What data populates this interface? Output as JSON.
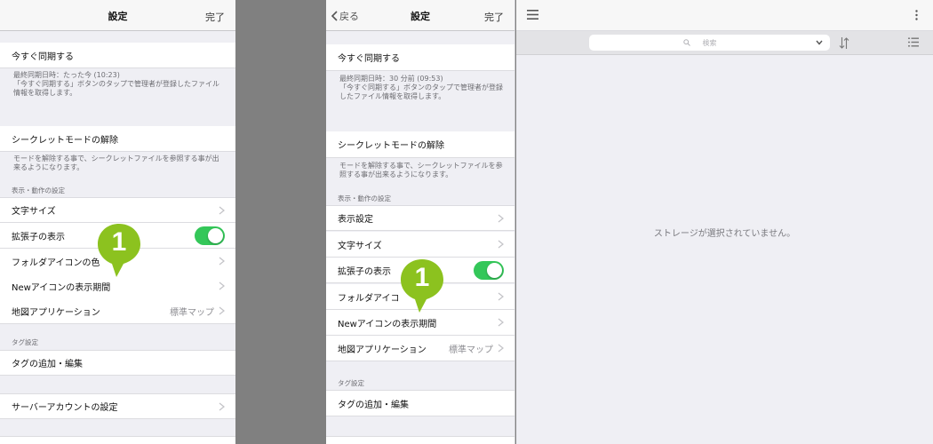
{
  "left": {
    "nav_title": "設定",
    "done_label": "完了",
    "sync_now": "今すぐ同期する",
    "sync_note": "最終同期日時：たった今 (10:23)\n「今すぐ同期する」ボタンのタップで管理者が登録したファイル情報を取得します。",
    "secret_mode": "シークレットモードの解除",
    "secret_note": "モードを解除する事で、シークレットファイルを参照する事が出来るようになります。",
    "display_section": "表示・動作の設定",
    "font_size": "文字サイズ",
    "show_ext": "拡張子の表示",
    "folder_icon_color": "フォルダアイコンの色",
    "new_icon_period": "Newアイコンの表示期間",
    "map_app": "地図アプリケーション",
    "map_app_value": "標準マップ",
    "tag_section": "タグ設定",
    "tag_add_edit": "タグの追加・編集",
    "server_account": "サーバーアカウントの設定",
    "marker": "1"
  },
  "middle": {
    "back_label": "戻る",
    "nav_title": "設定",
    "done_label": "完了",
    "sync_now": "今すぐ同期する",
    "sync_note": "最終同期日時：30 分前 (09:53)\n「今すぐ同期する」ボタンのタップで管理者が登録したファイル情報を取得します。",
    "secret_mode": "シークレットモードの解除",
    "secret_note": "モードを解除する事で、シークレットファイルを参照する事が出来るようになります。",
    "display_section": "表示・動作の設定",
    "display_settings": "表示設定",
    "font_size": "文字サイズ",
    "show_ext": "拡張子の表示",
    "folder_icon": "フォルダアイコ",
    "new_icon_period": "Newアイコンの表示期間",
    "map_app": "地図アプリケーション",
    "map_app_value": "標準マップ",
    "tag_section": "タグ設定",
    "tag_add_edit": "タグの追加・編集",
    "marker": "1"
  },
  "right": {
    "search_placeholder": "検索",
    "empty_message": "ストレージが選択されていません。"
  },
  "colors": {
    "toggle_on": "#34c759",
    "marker": "#8cc21f"
  },
  "toggles": {
    "left_show_ext": true,
    "middle_show_ext": true
  }
}
